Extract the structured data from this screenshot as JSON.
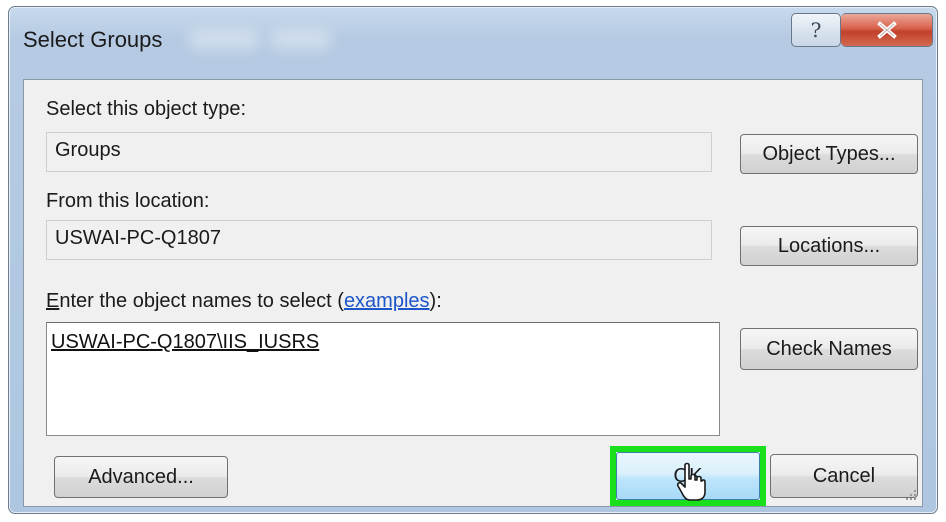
{
  "dialog": {
    "title": "Select Groups",
    "help_glyph": "?",
    "close_glyph": "X"
  },
  "object_type": {
    "label": "Select this object type:",
    "value": "Groups",
    "button": "Object Types..."
  },
  "location": {
    "label": "From this location:",
    "value": "USWAI-PC-Q1807",
    "button": "Locations..."
  },
  "names": {
    "label_prefix_mnemonic": "E",
    "label_prefix_rest": "nter the object names to select (",
    "examples_link": "examples",
    "label_suffix": "):",
    "value": "USWAI-PC-Q1807\\IIS_IUSRS",
    "button": "Check Names"
  },
  "footer": {
    "advanced_button": "Advanced...",
    "ok_button": "OK",
    "cancel_button": "Cancel"
  },
  "colors": {
    "highlight": "#19e01a",
    "close": "#c0402b",
    "link": "#1c56c8"
  }
}
